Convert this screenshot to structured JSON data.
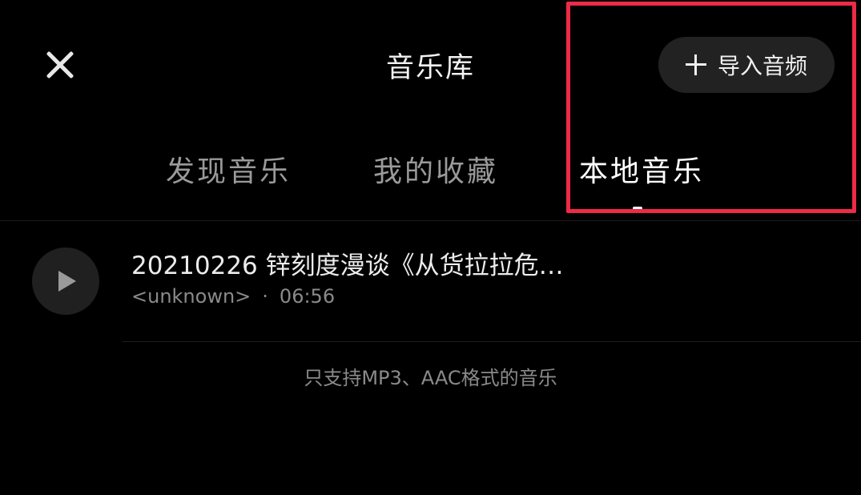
{
  "header": {
    "title": "音乐库",
    "import_label": "导入音频"
  },
  "tabs": [
    {
      "label": "发现音乐",
      "active": false
    },
    {
      "label": "我的收藏",
      "active": false
    },
    {
      "label": "本地音乐",
      "active": true
    }
  ],
  "tracks": [
    {
      "title": "20210226 锌刻度漫谈《从货拉拉危…",
      "artist": "<unknown>",
      "separator": "·",
      "duration": "06:56"
    }
  ],
  "footer_note": "只支持MP3、AAC格式的音乐",
  "colors": {
    "background": "#000000",
    "highlight_border": "#ee2a47",
    "button_bg": "#222222"
  },
  "icons": [
    "close-icon",
    "plus-icon",
    "play-icon"
  ]
}
